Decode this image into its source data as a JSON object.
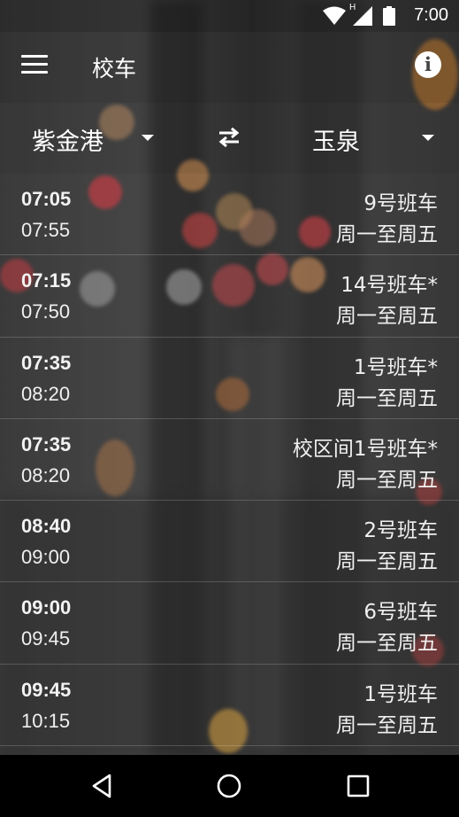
{
  "status_bar": {
    "time": "7:00",
    "icons": [
      "wifi-icon",
      "signal-icon",
      "battery-icon"
    ],
    "network_label": "H"
  },
  "app_bar": {
    "title": "校车",
    "menu_icon": "menu-icon",
    "info_icon": "info-icon",
    "info_glyph": "i"
  },
  "route": {
    "from": "紫金港",
    "to": "玉泉",
    "swap_icon": "swap-arrows-icon"
  },
  "schedule": [
    {
      "depart": "07:05",
      "arrive": "07:55",
      "bus": "9号班车",
      "days": "周一至周五"
    },
    {
      "depart": "07:15",
      "arrive": "07:50",
      "bus": "14号班车*",
      "days": "周一至周五"
    },
    {
      "depart": "07:35",
      "arrive": "08:20",
      "bus": "1号班车*",
      "days": "周一至周五"
    },
    {
      "depart": "07:35",
      "arrive": "08:20",
      "bus": "校区间1号班车*",
      "days": "周一至周五"
    },
    {
      "depart": "08:40",
      "arrive": "09:00",
      "bus": "2号班车",
      "days": "周一至周五"
    },
    {
      "depart": "09:00",
      "arrive": "09:45",
      "bus": "6号班车",
      "days": "周一至周五"
    },
    {
      "depart": "09:45",
      "arrive": "10:15",
      "bus": "1号班车",
      "days": "周一至周五"
    }
  ],
  "nav_bar": {
    "icons": [
      "back-icon",
      "home-icon",
      "recents-icon"
    ]
  },
  "colors": {
    "text": "#ffffff",
    "navbar": "#000000",
    "bokeh_red": "#d9363e",
    "bokeh_orange": "#f0a050"
  }
}
